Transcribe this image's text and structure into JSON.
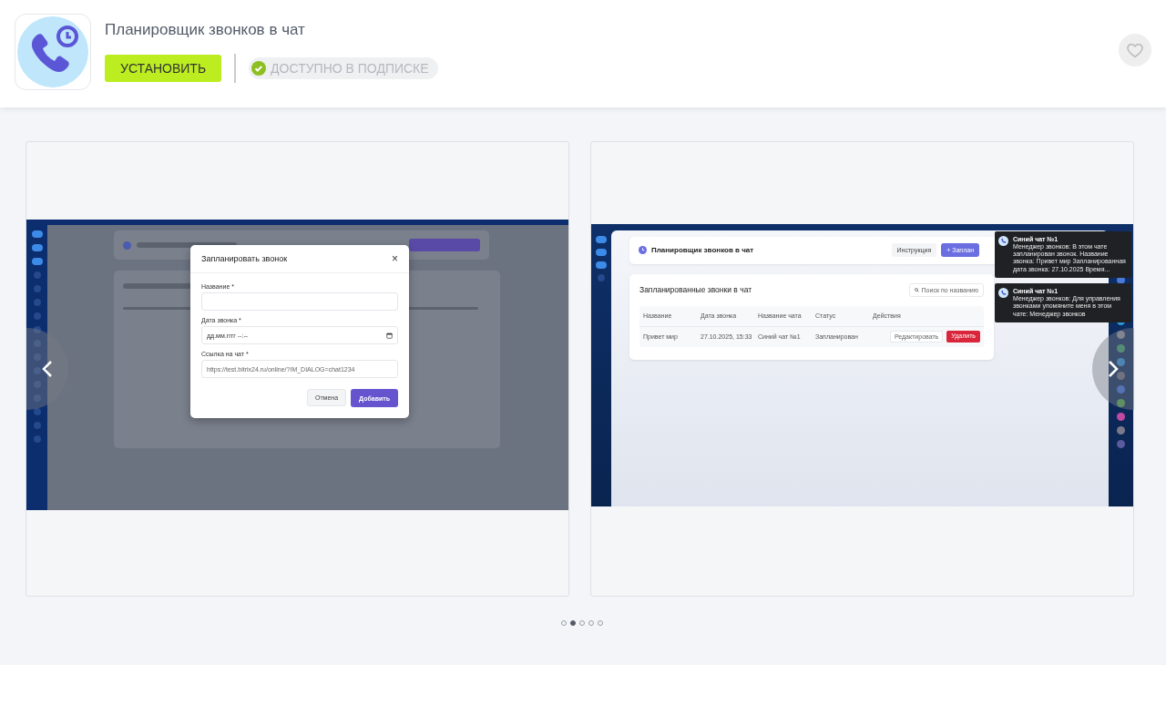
{
  "app": {
    "title": "Планировщик звонков в чат",
    "install_label": "УСТАНОВИТЬ",
    "subscription_label": "ДОСТУПНО В ПОДПИСКЕ",
    "favorite": {
      "selected": false
    }
  },
  "gallery": {
    "slides": [
      {
        "kind": "modal_form",
        "dialog": {
          "title": "Запланировать звонок",
          "close": "×",
          "fields": [
            {
              "label": "Название *",
              "kind": "text"
            },
            {
              "label": "Дата звонка *",
              "placeholder": "дд.мм.гггг --:--",
              "kind": "date"
            },
            {
              "label": "Ссылка на чат *",
              "placeholder": "https://test.bitrix24.ru/online/?IM_DIALOG=chat1234",
              "kind": "text"
            }
          ],
          "cancel": "Отмена",
          "submit": "Добавить"
        }
      },
      {
        "kind": "table_view",
        "header": {
          "title": "Планировщик звонков в чат",
          "guide": "Инструкция",
          "add": "+ Заплан"
        },
        "section": {
          "title": "Запланированные звонки в чат",
          "search_placeholder": "Поиск по названию",
          "columns": [
            "Название",
            "Дата звонка",
            "Название чата",
            "Статус",
            "Действия"
          ],
          "rows": [
            {
              "cells": [
                "Привет мир",
                "27.10.2025, 15:33",
                "Синий чат №1",
                "Запланирован"
              ],
              "edit": "Редактировать",
              "delete": "Удалить"
            }
          ]
        },
        "notifications": [
          {
            "title": "Синий чат №1",
            "text": "Менеджер звонков: В этом чате запланирован звонок. Название звонка: Привет мир Запланированная дата звонка: 27.10.2025 Время..."
          },
          {
            "title": "Синий чат №1",
            "text": "Менеджер звонков: Для управления звонками упомяните меня в этом чате: Менеджер звонков"
          }
        ]
      }
    ],
    "dots": [
      {
        "selected": false
      },
      {
        "selected": true
      },
      {
        "selected": false
      },
      {
        "selected": false
      },
      {
        "selected": false
      }
    ]
  }
}
